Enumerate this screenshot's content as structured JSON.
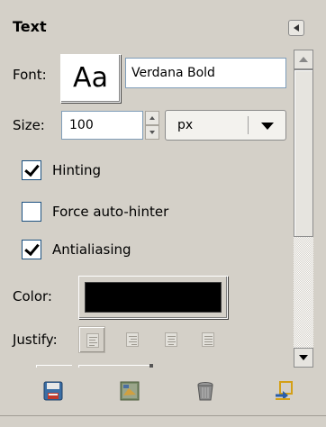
{
  "header": {
    "title": "Text"
  },
  "font": {
    "label": "Font:",
    "preview": "Aa",
    "value": "Verdana Bold"
  },
  "size": {
    "label": "Size:",
    "value": "100",
    "unit": "px"
  },
  "options": [
    {
      "label": "Hinting",
      "checked": true
    },
    {
      "label": "Force auto-hinter",
      "checked": false
    },
    {
      "label": "Antialiasing",
      "checked": true
    }
  ],
  "color": {
    "label": "Color:",
    "value": "#000000"
  },
  "justify": {
    "label": "Justify:",
    "modes": [
      "justify-left",
      "justify-right",
      "justify-center",
      "justify-fill"
    ],
    "selected": "justify-left"
  },
  "bottom_buttons": [
    "save-options-icon",
    "restore-from-texture-icon",
    "delete-icon",
    "reset-icon"
  ]
}
